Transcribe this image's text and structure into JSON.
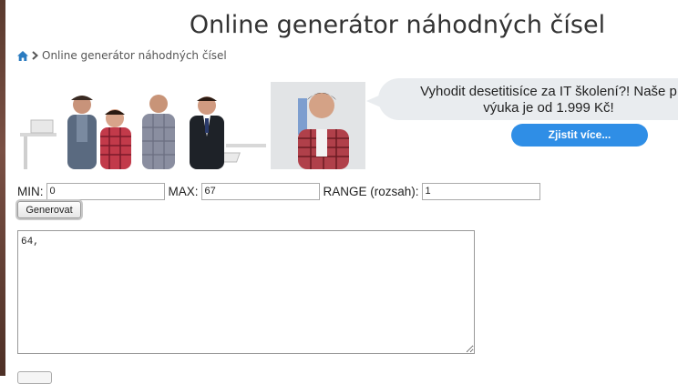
{
  "page": {
    "title": "Online generátor náhodných čísel"
  },
  "breadcrumb": {
    "home_icon": "home-icon",
    "current": "Online generátor náhodných čísel"
  },
  "banner": {
    "speech_line1": "Vyhodit desetitisíce za IT školení?! Naše p",
    "speech_line2": "výuka je od 1.999 Kč!",
    "cta_label": "Zjistit více..."
  },
  "form": {
    "min_label": "MIN:",
    "min_value": "0",
    "max_label": "MAX:",
    "max_value": "67",
    "range_label": "RANGE (rozsah):",
    "range_value": "1",
    "generate_label": "Generovat"
  },
  "output": {
    "value": "64,"
  },
  "colors": {
    "accent": "#2f8ee6",
    "link": "#2a7bc0",
    "bubble": "#e9ecef"
  }
}
